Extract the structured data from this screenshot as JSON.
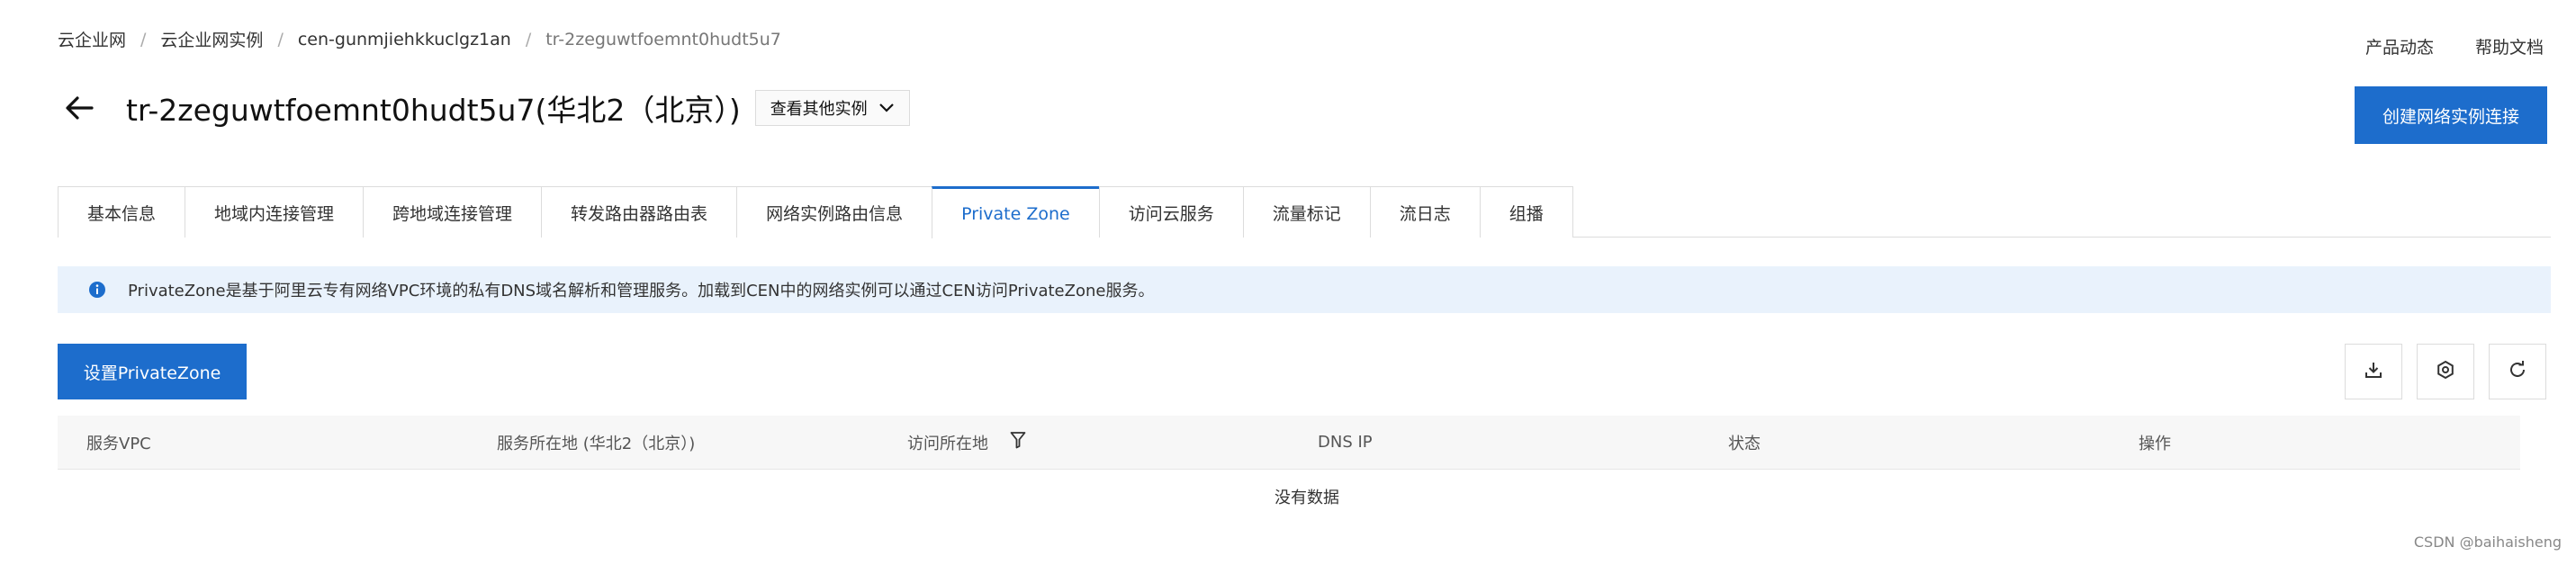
{
  "breadcrumb": {
    "items": [
      "云企业网",
      "云企业网实例",
      "cen-gunmjiehkkuclgz1an",
      "tr-2zeguwtfoemnt0hudt5u7"
    ],
    "separator": "/"
  },
  "top_links": {
    "product_news": "产品动态",
    "help_docs": "帮助文档"
  },
  "header": {
    "title": "tr-2zeguwtfoemnt0hudt5u7(华北2（北京）)",
    "instance_switch": "查看其他实例",
    "create_button": "创建网络实例连接"
  },
  "tabs": [
    "基本信息",
    "地域内连接管理",
    "跨地域连接管理",
    "转发路由器路由表",
    "网络实例路由信息",
    "Private Zone",
    "访问云服务",
    "流量标记",
    "流日志",
    "组播"
  ],
  "active_tab": "Private Zone",
  "alert": {
    "text": "PrivateZone是基于阿里云专有网络VPC环境的私有DNS域名解析和管理服务。加载到CEN中的网络实例可以通过CEN访问PrivateZone服务。"
  },
  "toolbar": {
    "set_button": "设置PrivateZone",
    "download_icon": "download-icon",
    "settings_icon": "gear-icon",
    "refresh_icon": "refresh-icon"
  },
  "table": {
    "columns": [
      "服务VPC",
      "服务所在地 (华北2（北京）)",
      "访问所在地",
      "DNS IP",
      "状态",
      "操作"
    ],
    "empty_text": "没有数据"
  },
  "watermark": "CSDN @baihaisheng",
  "colors": {
    "primary": "#1d6dcc",
    "alert_bg": "#e9f2fc"
  }
}
